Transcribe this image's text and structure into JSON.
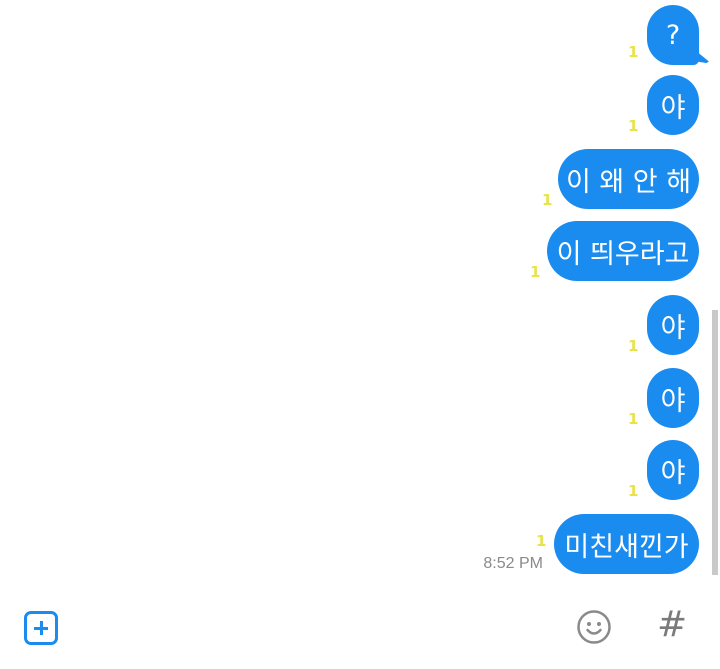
{
  "messages": [
    {
      "text": "?",
      "unread": "1"
    },
    {
      "text": "야",
      "unread": "1"
    },
    {
      "text": "이 왜 안 해",
      "unread": "1"
    },
    {
      "text": "이 띄우라고",
      "unread": "1"
    },
    {
      "text": "야",
      "unread": "1"
    },
    {
      "text": "야",
      "unread": "1"
    },
    {
      "text": "야",
      "unread": "1"
    },
    {
      "text": "미친새낀가",
      "unread": "1"
    }
  ],
  "last_timestamp": "8:52 PM",
  "toolbar": {
    "add_icon": "plus-square-icon",
    "emoji_icon": "smiley-icon",
    "hash_label": "#"
  },
  "colors": {
    "bubble": "#1a8cf0",
    "unread": "#e9e24a",
    "timestamp": "#8a8a8a"
  }
}
